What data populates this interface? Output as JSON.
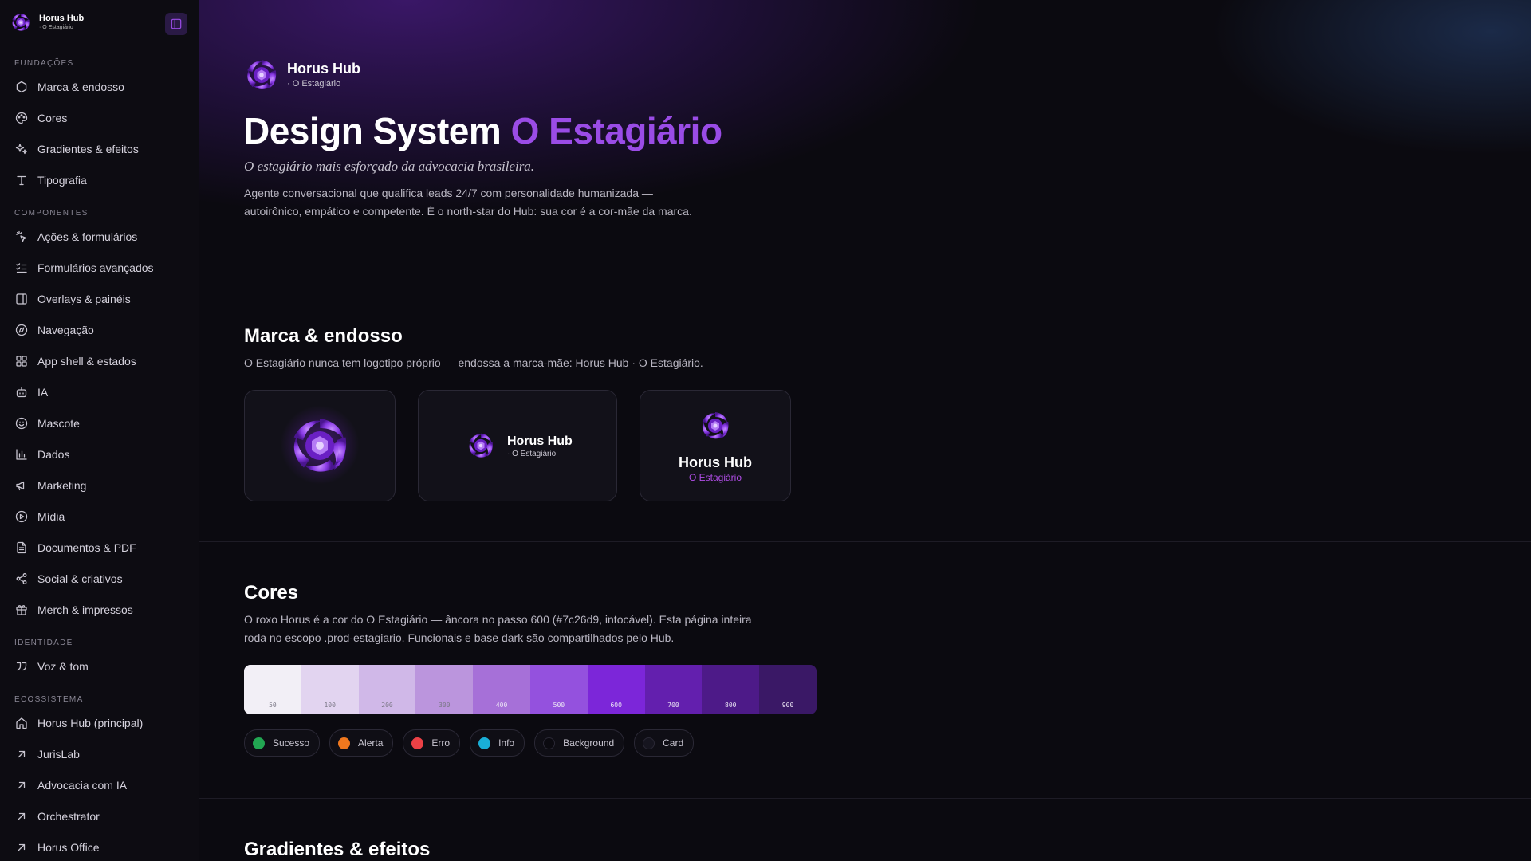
{
  "sidebar": {
    "brand": {
      "title": "Horus Hub",
      "subtitle": "· O Estagiário"
    },
    "sections": [
      {
        "label": "FUNDAÇÕES",
        "items": [
          {
            "label": "Marca & endosso",
            "icon": "hexagon-icon"
          },
          {
            "label": "Cores",
            "icon": "palette-icon"
          },
          {
            "label": "Gradientes & efeitos",
            "icon": "sparkles-icon"
          },
          {
            "label": "Tipografia",
            "icon": "type-icon"
          }
        ]
      },
      {
        "label": "COMPONENTES",
        "items": [
          {
            "label": "Ações & formulários",
            "icon": "cursor-click-icon"
          },
          {
            "label": "Formulários avançados",
            "icon": "list-checks-icon"
          },
          {
            "label": "Overlays & painéis",
            "icon": "panel-icon"
          },
          {
            "label": "Navegação",
            "icon": "compass-icon"
          },
          {
            "label": "App shell & estados",
            "icon": "layout-grid-icon"
          },
          {
            "label": "IA",
            "icon": "bot-icon"
          },
          {
            "label": "Mascote",
            "icon": "smile-icon"
          },
          {
            "label": "Dados",
            "icon": "bar-chart-icon"
          },
          {
            "label": "Marketing",
            "icon": "megaphone-icon"
          },
          {
            "label": "Mídia",
            "icon": "play-circle-icon"
          },
          {
            "label": "Documentos & PDF",
            "icon": "file-text-icon"
          },
          {
            "label": "Social & criativos",
            "icon": "share-icon"
          },
          {
            "label": "Merch & impressos",
            "icon": "gift-icon"
          }
        ]
      },
      {
        "label": "IDENTIDADE",
        "items": [
          {
            "label": "Voz & tom",
            "icon": "quote-icon"
          }
        ]
      },
      {
        "label": "ECOSSISTEMA",
        "items": [
          {
            "label": "Horus Hub (principal)",
            "icon": "home-icon"
          },
          {
            "label": "JurisLab",
            "icon": "arrow-up-right-icon"
          },
          {
            "label": "Advocacia com IA",
            "icon": "arrow-up-right-icon"
          },
          {
            "label": "Orchestrator",
            "icon": "arrow-up-right-icon"
          },
          {
            "label": "Horus Office",
            "icon": "arrow-up-right-icon"
          }
        ]
      }
    ]
  },
  "hero": {
    "brand_title": "Horus Hub",
    "brand_subtitle": "· O Estagiário",
    "title": "Design System",
    "title_accent": "O Estagiário",
    "tagline": "O estagiário mais esforçado da advocacia brasileira.",
    "intro": "Agente conversacional que qualifica leads 24/7 com personalidade humanizada — autoirônico, empático e competente. É o north-star do Hub: sua cor é a cor-mãe da marca."
  },
  "brand_section": {
    "title": "Marca & endosso",
    "description": "O Estagiário nunca tem logotipo próprio — endossa a marca-mãe: Horus Hub · O Estagiário.",
    "horizontal_title": "Horus Hub",
    "horizontal_subtitle": "· O Estagiário",
    "stacked_title": "Horus Hub",
    "stacked_subtitle": "O Estagiário"
  },
  "colors_section": {
    "title": "Cores",
    "description": "O roxo Horus é a cor do O Estagiário — âncora no passo 600 (#7c26d9, intocável). Esta página inteira roda no escopo .prod-estagiario. Funcionais e base dark são compartilhados pelo Hub.",
    "swatches": [
      {
        "step": "50",
        "color": "#f2eff6"
      },
      {
        "step": "100",
        "color": "#e2d4f0"
      },
      {
        "step": "200",
        "color": "#d0b8e8"
      },
      {
        "step": "300",
        "color": "#bb95dd"
      },
      {
        "step": "400",
        "color": "#a670d8"
      },
      {
        "step": "500",
        "color": "#9451de"
      },
      {
        "step": "600",
        "color": "#7c26d9"
      },
      {
        "step": "700",
        "color": "#631fae"
      },
      {
        "step": "800",
        "color": "#4d1a88"
      },
      {
        "step": "900",
        "color": "#3a1866"
      }
    ],
    "chips": [
      {
        "label": "Sucesso",
        "color": "#22a652"
      },
      {
        "label": "Alerta",
        "color": "#f0781e"
      },
      {
        "label": "Erro",
        "color": "#ec4146"
      },
      {
        "label": "Info",
        "color": "#19aed6"
      },
      {
        "label": "Background",
        "color": "#0b0a10"
      },
      {
        "label": "Card",
        "color": "#16151f"
      }
    ]
  },
  "gradients_section": {
    "title": "Gradientes & efeitos"
  }
}
